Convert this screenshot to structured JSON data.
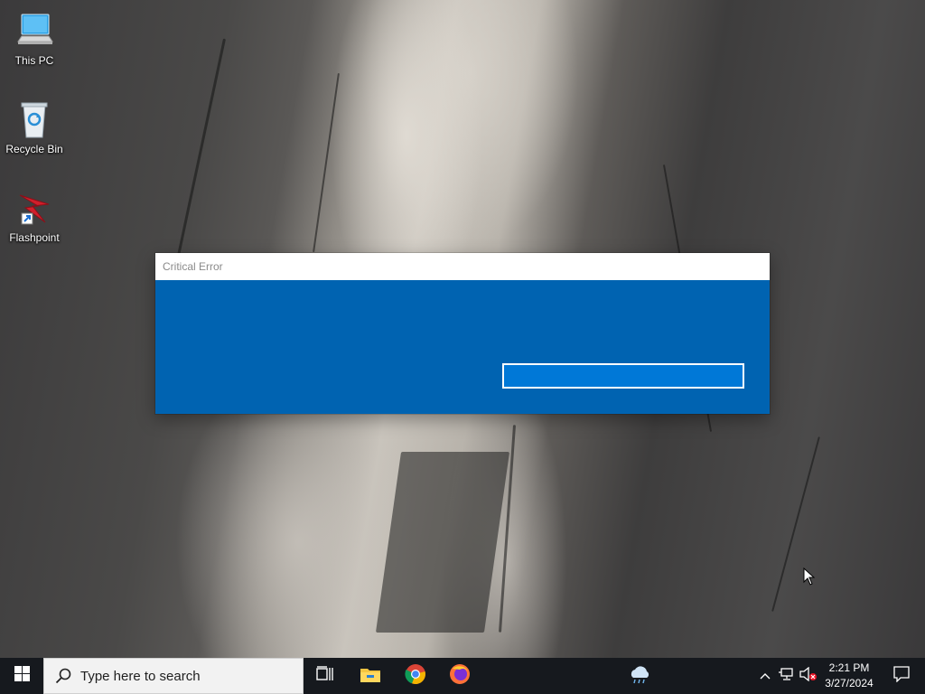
{
  "desktop": {
    "icons": [
      {
        "label": "This PC",
        "icon": "computer-icon"
      },
      {
        "label": "Recycle Bin",
        "icon": "recycle-bin-icon"
      },
      {
        "label": "Flashpoint",
        "icon": "flashpoint-icon"
      }
    ]
  },
  "dialog": {
    "title": "Critical Error",
    "action_label": "",
    "colors": {
      "title_bg": "#ffffff",
      "body_bg": "#0063b1",
      "button_bg": "#0078d7",
      "button_border": "#ffffff"
    }
  },
  "taskbar": {
    "search_placeholder": "Type here to search",
    "pinned": [
      "task-view-icon",
      "file-explorer-icon",
      "chrome-icon",
      "firefox-icon"
    ],
    "weather_icon": "weather-icon",
    "tray_icons": [
      "show-hidden-icons-chevron",
      "network-icon",
      "volume-muted-icon"
    ],
    "clock": {
      "time": "2:21 PM",
      "date": "3/27/2024"
    },
    "notification_icon": "action-center-icon"
  }
}
